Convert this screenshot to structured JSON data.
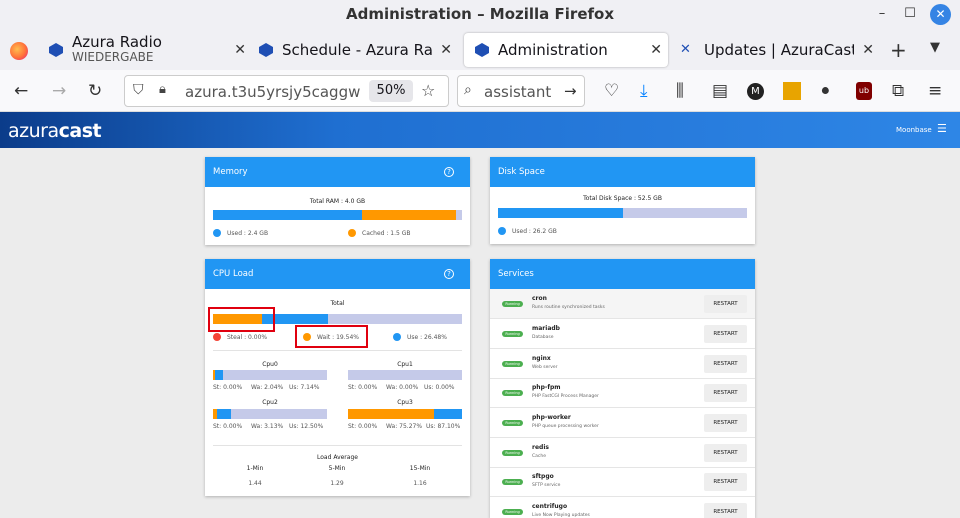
{
  "browser": {
    "window_title": "Administration – Mozilla Firefox",
    "tabs": [
      {
        "label": "Azura Radio",
        "sub": "WIEDERGABE"
      },
      {
        "label": "Schedule - Azura Rad"
      },
      {
        "label": "Administration"
      },
      {
        "label": "Updates | AzuraCast"
      }
    ],
    "url": "azura.t3u5yrsjy5caggw",
    "zoom": "50%",
    "search_text": "assistant"
  },
  "app": {
    "logo_light": "azura",
    "logo_bold": "cast",
    "station": "Moonbase"
  },
  "memory": {
    "title": "Memory",
    "total": "Total RAM : 4.0 GB",
    "used_label": "Used : 2.4 GB",
    "cached_label": "Cached : 1.5 GB",
    "used_pct": 60,
    "cached_pct": 37.5
  },
  "disk": {
    "title": "Disk Space",
    "total": "Total Disk Space : 52.5 GB",
    "used_label": "Used : 26.2 GB",
    "used_pct": 50
  },
  "cpu": {
    "title": "CPU Load",
    "total_label": "Total",
    "steal_label": "Steal : 0.00%",
    "wait_label": "Wait : 19.54%",
    "use_label": "Use : 26.48%",
    "total_wait": 19.54,
    "total_use": 26.48,
    "cores": [
      {
        "name": "Cpu0",
        "st": "St: 0.00%",
        "wa": "Wa: 2.04%",
        "us": "Us: 7.14%",
        "wa_v": 2.04,
        "us_v": 7.14
      },
      {
        "name": "Cpu1",
        "st": "St: 0.00%",
        "wa": "Wa: 0.00%",
        "us": "Us: 0.00%",
        "wa_v": 0,
        "us_v": 0
      },
      {
        "name": "Cpu2",
        "st": "St: 0.00%",
        "wa": "Wa: 3.13%",
        "us": "Us: 12.50%",
        "wa_v": 3.13,
        "us_v": 12.5
      },
      {
        "name": "Cpu3",
        "st": "St: 0.00%",
        "wa": "Wa: 75.27%",
        "us": "Us: 87.10%",
        "wa_v": 75.27,
        "us_v": 87.1
      }
    ],
    "load_title": "Load Average",
    "load": [
      {
        "label": "1-Min",
        "value": "1.44"
      },
      {
        "label": "5-Min",
        "value": "1.29"
      },
      {
        "label": "15-Min",
        "value": "1.16"
      }
    ]
  },
  "services": {
    "title": "Services",
    "badge": "Running",
    "restart_label": "RESTART",
    "items": [
      {
        "name": "cron",
        "desc": "Runs routine synchronized tasks"
      },
      {
        "name": "mariadb",
        "desc": "Database"
      },
      {
        "name": "nginx",
        "desc": "Web server"
      },
      {
        "name": "php-fpm",
        "desc": "PHP FastCGI Process Manager"
      },
      {
        "name": "php-worker",
        "desc": "PHP queue processing worker"
      },
      {
        "name": "redis",
        "desc": "Cache"
      },
      {
        "name": "sftpgo",
        "desc": "SFTP service"
      },
      {
        "name": "centrifugo",
        "desc": "Live Now Playing updates"
      }
    ]
  },
  "colors": {
    "blue": "#2196f3",
    "orange": "#ff9800",
    "red": "#f44336",
    "track": "#c5cae9",
    "highlight": "#e0000f"
  }
}
